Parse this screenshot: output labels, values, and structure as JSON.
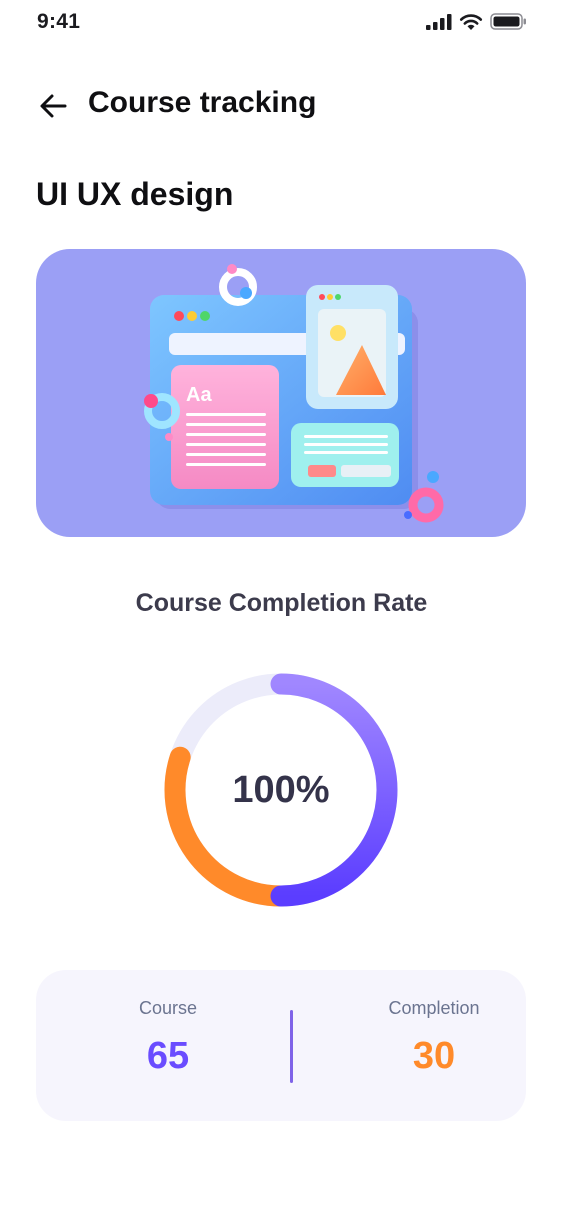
{
  "status_bar": {
    "time": "9:41"
  },
  "header": {
    "title": "Course tracking"
  },
  "course": {
    "name": "UI UX design"
  },
  "illustration": {
    "badge_text": "Aa"
  },
  "completion": {
    "title": "Course Completion Rate",
    "value_label": "100%",
    "ring_segments": [
      {
        "name": "purple",
        "fraction": 0.5,
        "color": "#6a4cff"
      },
      {
        "name": "orange",
        "fraction": 0.3,
        "color": "#ff8a2a"
      },
      {
        "name": "track",
        "fraction": 0.2,
        "color": "#ececfa"
      }
    ]
  },
  "stats": {
    "course_label": "Course",
    "course_value": "65",
    "completion_label": "Completion",
    "completion_value": "30",
    "course_color": "#6a4cff",
    "completion_color": "#ff8a2a"
  },
  "colors": {
    "accent_purple": "#6a4cff",
    "accent_orange": "#ff8a2a",
    "banner_bg": "#9b9ff5",
    "card_bg": "#f6f5fd"
  },
  "icons": {
    "back": "arrow-left-icon",
    "signal": "cellular-signal-icon",
    "wifi": "wifi-icon",
    "battery": "battery-icon"
  }
}
